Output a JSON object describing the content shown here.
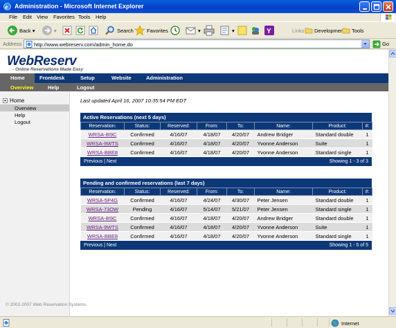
{
  "window": {
    "title": "Administration - Microsoft Internet Explorer"
  },
  "menu": [
    "File",
    "Edit",
    "View",
    "Favorites",
    "Tools",
    "Help"
  ],
  "toolbar": {
    "back_label": "Back",
    "search_label": "Search",
    "favorites_label": "Favorites",
    "links_label": "Links",
    "development_label": "Development",
    "tools_label": "Tools"
  },
  "address": {
    "label": "Address",
    "url": "http://www.webreserv.com/admin_home.do",
    "go_label": "Go"
  },
  "site": {
    "logo": "WebReserv",
    "tagline": "- Online Reservations Made Easy",
    "nav": [
      "Home",
      "Frontdesk",
      "Setup",
      "Website",
      "Administration"
    ],
    "subnav": [
      "Overview",
      "Help",
      "Logout"
    ]
  },
  "sidebar": {
    "home": "Home",
    "items": [
      "Overview",
      "Help",
      "Logout"
    ]
  },
  "last_updated": "Last updated April 16, 2007 10:35:54 PM EDT",
  "columns": [
    "Reservation:",
    "Status:",
    "Reserved:",
    "From:",
    "To:",
    "Name:",
    "Product:",
    "#:"
  ],
  "active": {
    "title": "Active Reservations (next 5 days)",
    "rows": [
      [
        "WRSA-8I9C",
        "Confirmed",
        "4/16/07",
        "4/18/07",
        "4/20/07",
        "Andrew Bridger",
        "Standard double",
        "1"
      ],
      [
        "WRSA-9WTS",
        "Confirmed",
        "4/16/07",
        "4/18/07",
        "4/20/07",
        "Yvonne Anderson",
        "Suite",
        "1"
      ],
      [
        "WRSA-BBE8",
        "Confirmed",
        "4/16/07",
        "4/18/07",
        "4/20/07",
        "Yvonne Anderson",
        "Standard single",
        "1"
      ]
    ],
    "pager": "Previous | Next",
    "showing": "Showing 1 - 3 of 3"
  },
  "pending": {
    "title": "Pending and confirmed reservations (last 7 days)",
    "rows": [
      [
        "WRSA-5P4G",
        "Confirmed",
        "4/16/07",
        "4/24/07",
        "4/30/07",
        "Peter Jensen",
        "Standard double",
        "1"
      ],
      [
        "WRSA-73OW",
        "Pending",
        "4/16/07",
        "5/14/07",
        "5/21/07",
        "Peter Jensen",
        "Standard single",
        "1"
      ],
      [
        "WRSA-8I9C",
        "Confirmed",
        "4/16/07",
        "4/18/07",
        "4/20/07",
        "Andrew Bridger",
        "Standard double",
        "1"
      ],
      [
        "WRSA-9WTS",
        "Confirmed",
        "4/16/07",
        "4/18/07",
        "4/20/07",
        "Yvonne Anderson",
        "Suite",
        "1"
      ],
      [
        "WRSA-BBE8",
        "Confirmed",
        "4/16/07",
        "4/18/07",
        "4/20/07",
        "Yvonne Anderson",
        "Standard single",
        "1"
      ]
    ],
    "pager": "Previous | Next",
    "showing": "Showing 1 - 5 of 5"
  },
  "footer": "© 2002-2007 Web Reservation Systems.",
  "status": {
    "zone": "Internet"
  }
}
